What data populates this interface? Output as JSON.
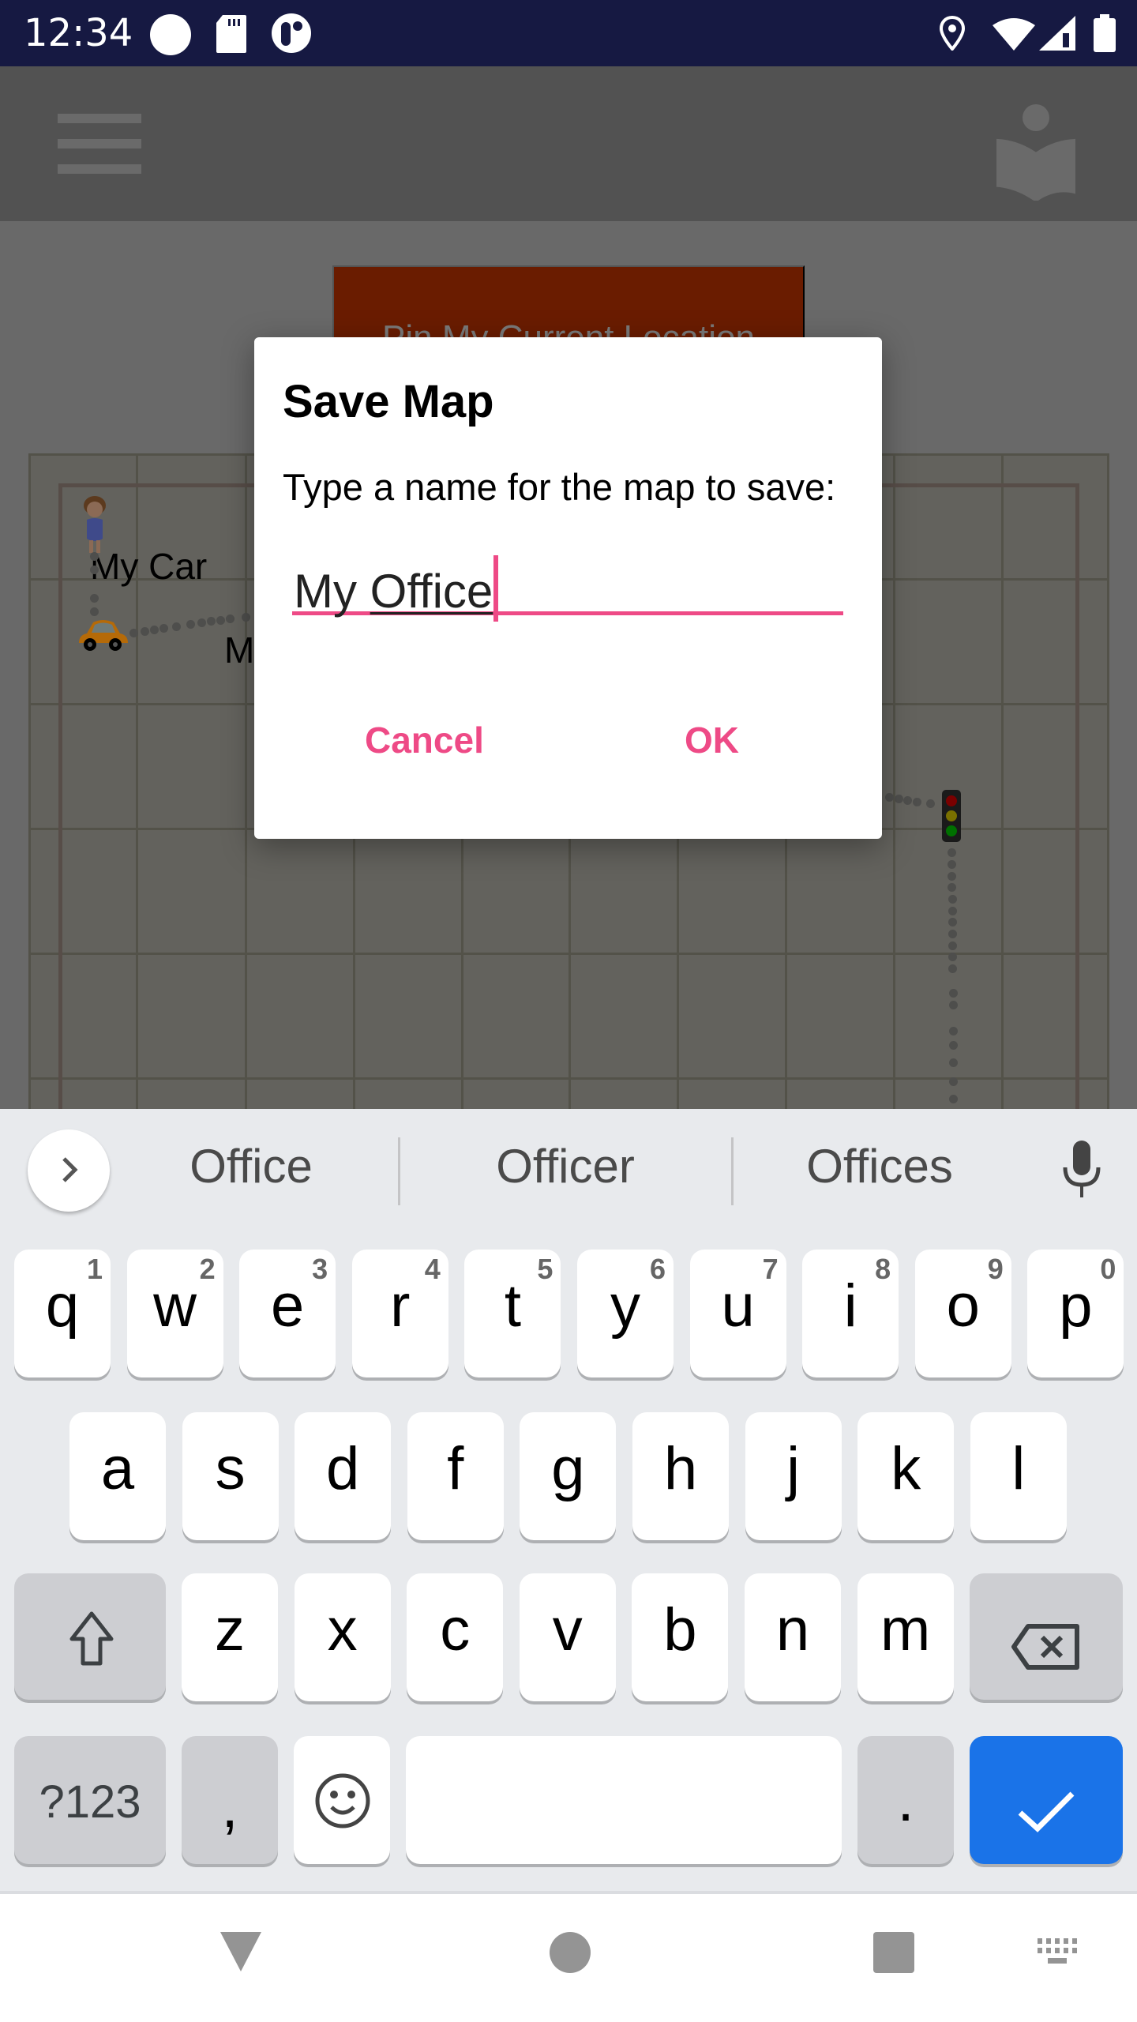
{
  "status_bar": {
    "time": "12:34",
    "left_icons": [
      "circle-notification-icon",
      "sd-card-icon",
      "pause-circle-icon"
    ],
    "right_icons": [
      "location-icon",
      "wifi-icon",
      "cell-signal-icon",
      "battery-icon"
    ]
  },
  "app_bar": {
    "menu_icon": "hamburger-menu-icon",
    "action_icon": "book-reader-icon"
  },
  "content": {
    "pin_button_label": "Pin My Current Location",
    "pin_button_color": "#6a1c00",
    "map": {
      "labels": [
        {
          "text": "My Car",
          "marker": "car-icon"
        },
        {
          "text": "M",
          "marker": ""
        }
      ],
      "markers": [
        "person-icon",
        "car-icon",
        "traffic-light-icon"
      ]
    }
  },
  "dialog": {
    "title": "Save Map",
    "message": "Type a name for the map to save:",
    "input": {
      "value_prefix": "My ",
      "value_composing": "Office",
      "value": "My Office",
      "placeholder": ""
    },
    "cancel_label": "Cancel",
    "ok_label": "OK",
    "accent_color": "#ee4a86"
  },
  "keyboard": {
    "suggestions": [
      "Office",
      "Officer",
      "Offices"
    ],
    "row1": [
      {
        "key": "q",
        "hint": "1"
      },
      {
        "key": "w",
        "hint": "2"
      },
      {
        "key": "e",
        "hint": "3"
      },
      {
        "key": "r",
        "hint": "4"
      },
      {
        "key": "t",
        "hint": "5"
      },
      {
        "key": "y",
        "hint": "6"
      },
      {
        "key": "u",
        "hint": "7"
      },
      {
        "key": "i",
        "hint": "8"
      },
      {
        "key": "o",
        "hint": "9"
      },
      {
        "key": "p",
        "hint": "0"
      }
    ],
    "row2": [
      "a",
      "s",
      "d",
      "f",
      "g",
      "h",
      "j",
      "k",
      "l"
    ],
    "row3": [
      "z",
      "x",
      "c",
      "v",
      "b",
      "n",
      "m"
    ],
    "symbols_label": "?123",
    "comma_label": ",",
    "period_label": ".",
    "enter_color": "#1a73e8"
  },
  "nav_bar": {
    "buttons": [
      "back-icon",
      "home-icon",
      "recents-icon",
      "keyboard-switch-icon"
    ]
  }
}
